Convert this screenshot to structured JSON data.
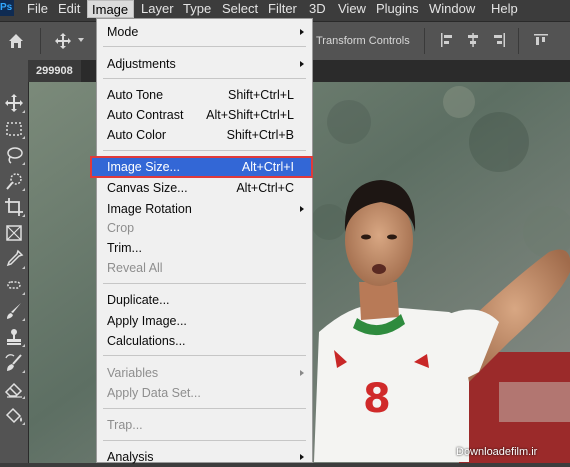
{
  "menubar": {
    "app_icon": "Ps",
    "items": [
      "File",
      "Edit",
      "Image",
      "Layer",
      "Type",
      "Select",
      "Filter",
      "3D",
      "View",
      "Plugins",
      "Window",
      "Help"
    ],
    "active": "Image"
  },
  "options_bar": {
    "transform_controls_label": "Transform Controls"
  },
  "document_tab": {
    "title": "299908"
  },
  "image_menu": {
    "items": [
      {
        "label": "Mode",
        "submenu": true
      },
      {
        "label": "Adjustments",
        "submenu": true
      },
      {
        "label": "Auto Tone",
        "shortcut": "Shift+Ctrl+L"
      },
      {
        "label": "Auto Contrast",
        "shortcut": "Alt+Shift+Ctrl+L"
      },
      {
        "label": "Auto Color",
        "shortcut": "Shift+Ctrl+B"
      },
      {
        "label": "Image Size...",
        "shortcut": "Alt+Ctrl+I",
        "highlighted": true
      },
      {
        "label": "Canvas Size...",
        "shortcut": "Alt+Ctrl+C"
      },
      {
        "label": "Image Rotation",
        "submenu": true
      },
      {
        "label": "Crop",
        "disabled": true
      },
      {
        "label": "Trim..."
      },
      {
        "label": "Reveal All",
        "disabled": true
      },
      {
        "label": "Duplicate..."
      },
      {
        "label": "Apply Image..."
      },
      {
        "label": "Calculations..."
      },
      {
        "label": "Variables",
        "submenu": true,
        "disabled": true
      },
      {
        "label": "Apply Data Set...",
        "disabled": true
      },
      {
        "label": "Trap...",
        "disabled": true
      },
      {
        "label": "Analysis",
        "submenu": true
      }
    ]
  },
  "canvas": {
    "jersey_number": "8"
  },
  "watermark": "Downloadefilm.ir",
  "colors": {
    "menubar_bg": "#3c3c3c",
    "panel_bg": "#535353",
    "menu_bg": "#f0f0f0",
    "highlight": "#3367d6",
    "highlight_border": "#e03a3a"
  },
  "icons": {
    "toolbar": [
      "move-icon",
      "marquee-icon",
      "lasso-icon",
      "quick-select-icon",
      "crop-icon",
      "frame-icon",
      "eyedropper-icon",
      "healing-brush-icon",
      "brush-icon",
      "stamp-icon",
      "history-brush-icon",
      "eraser-icon",
      "paint-bucket-icon"
    ]
  }
}
